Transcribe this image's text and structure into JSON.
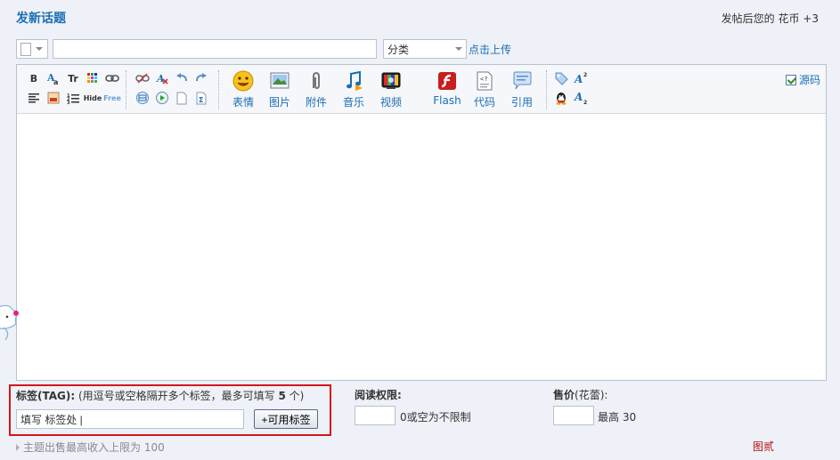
{
  "header": {
    "title": "发新话题",
    "credit_text": "发帖后您的 花币 +3"
  },
  "topbar": {
    "title_value": "",
    "category_value": "分类",
    "upload_label": "点击上传"
  },
  "toolbar": {
    "big_buttons": [
      "表情",
      "图片",
      "附件",
      "音乐",
      "视频",
      "Flash",
      "代码",
      "引用"
    ],
    "source_label": "源码",
    "icons": {
      "bold": "B",
      "font_size": "Tr",
      "hide": "Hide",
      "free": "Free"
    }
  },
  "editor": {
    "content": ""
  },
  "tags": {
    "label_bold": "标签(TAG):",
    "label_hint": " (用逗号或空格隔开多个标签，最多可填写 ",
    "label_max": "5",
    "label_end": " 个)",
    "input_value": "填写 标签处 |",
    "button_label": "+可用标签"
  },
  "permission": {
    "label": "阅读权限:",
    "value": "",
    "hint": "0或空为不限制"
  },
  "price": {
    "label_bold": "售价",
    "label_paren": "(花蕾):",
    "value": "",
    "hint": "最高 30"
  },
  "footer": {
    "note": "主题出售最高收入上限为 100",
    "image_link": "图贰"
  },
  "colors": {
    "accent": "#1a6fb0",
    "highlight_border": "#d4161c",
    "background": "#eef1f7"
  }
}
